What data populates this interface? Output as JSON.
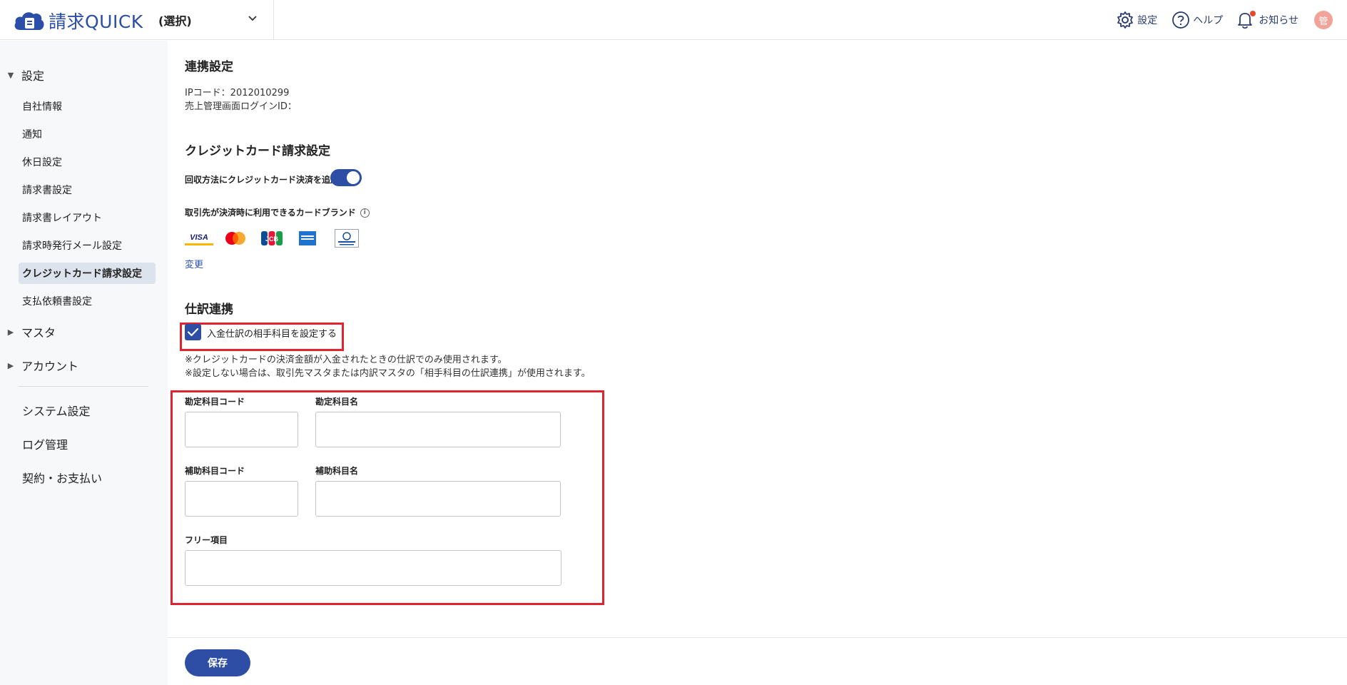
{
  "header": {
    "logo_text": "請求QUICK",
    "selector_value": "(選択)",
    "settings_label": "設定",
    "help_label": "ヘルプ",
    "notice_label": "お知らせ",
    "avatar_text": "管"
  },
  "sidebar": {
    "group_settings": "設定",
    "items": [
      {
        "label": "自社情報"
      },
      {
        "label": "通知"
      },
      {
        "label": "休日設定"
      },
      {
        "label": "請求書設定"
      },
      {
        "label": "請求書レイアウト"
      },
      {
        "label": "請求時発行メール設定"
      },
      {
        "label": "クレジットカード請求設定"
      },
      {
        "label": "支払依頼書設定"
      }
    ],
    "group_master": "マスタ",
    "group_account": "アカウント",
    "system_settings": "システム設定",
    "log_management": "ログ管理",
    "contract_payment": "契約・お支払い"
  },
  "main": {
    "link_title": "連携設定",
    "ip_code": "IPコード：2012010299",
    "sales_login_id": "売上管理画面ログインID：",
    "cc_title": "クレジットカード請求設定",
    "cc_toggle_label": "回収方法にクレジットカード決済を追加",
    "card_brands_label": "取引先が決済時に利用できるカードブランド",
    "change_link": "変更",
    "journal_title": "仕訳連携",
    "journal_checkbox_label": "入金仕訳の相手科目を設定する",
    "note1": "※クレジットカードの決済金額が入金されたときの仕訳でのみ使用されます。",
    "note2": "※設定しない場合は、取引先マスタまたは内訳マスタの「相手科目の仕訳連携」が使用されます。",
    "account_code_label": "勘定科目コード",
    "account_name_label": "勘定科目名",
    "sub_code_label": "補助科目コード",
    "sub_name_label": "補助科目名",
    "free_label": "フリー項目",
    "save_button": "保存"
  }
}
